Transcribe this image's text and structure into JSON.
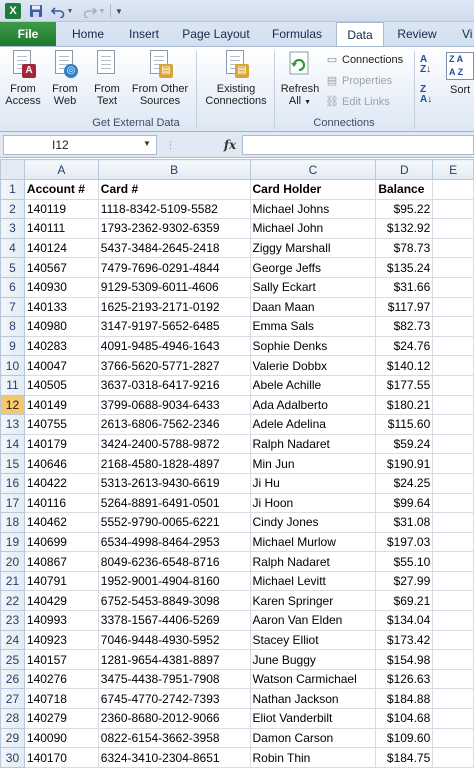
{
  "qat": {
    "logo": "X",
    "icons": [
      "excel-icon",
      "save-icon",
      "undo-icon",
      "redo-icon",
      "customize-icon"
    ]
  },
  "tabs": [
    {
      "id": "file",
      "label": "File"
    },
    {
      "id": "home",
      "label": "Home"
    },
    {
      "id": "insert",
      "label": "Insert"
    },
    {
      "id": "pagelayout",
      "label": "Page Layout"
    },
    {
      "id": "formulas",
      "label": "Formulas"
    },
    {
      "id": "data",
      "label": "Data",
      "active": true
    },
    {
      "id": "review",
      "label": "Review"
    },
    {
      "id": "view",
      "label": "Vi"
    }
  ],
  "ribbon": {
    "get_external": {
      "from_access": "From Access",
      "from_web": "From Web",
      "from_text": "From Text",
      "from_other": "From Other Sources",
      "label": "Get External Data"
    },
    "existing": "Existing Connections",
    "refresh": "Refresh All",
    "connections": {
      "connections": "Connections",
      "properties": "Properties",
      "edit_links": "Edit Links",
      "label": "Connections"
    },
    "sort": "Sort"
  },
  "formula_bar": {
    "name_box": "I12",
    "fx": "fx",
    "value": ""
  },
  "grid": {
    "columns": [
      "A",
      "B",
      "C",
      "D",
      "E"
    ],
    "active_row": 12,
    "header": [
      "Account #",
      "Card #",
      "Card Holder",
      "Balance"
    ],
    "rows": [
      [
        "140119",
        "1118-8342-5109-5582",
        "Michael Johns",
        "$95.22"
      ],
      [
        "140111",
        "1793-2362-9302-6359",
        "Michael John",
        "$132.92"
      ],
      [
        "140124",
        "5437-3484-2645-2418",
        "Ziggy Marshall",
        "$78.73"
      ],
      [
        "140567",
        "7479-7696-0291-4844",
        "George Jeffs",
        "$135.24"
      ],
      [
        "140930",
        "9129-5309-6011-4606",
        "Sally Eckart",
        "$31.66"
      ],
      [
        "140133",
        "1625-2193-2171-0192",
        "Daan Maan",
        "$117.97"
      ],
      [
        "140980",
        "3147-9197-5652-6485",
        "Emma Sals",
        "$82.73"
      ],
      [
        "140283",
        "4091-9485-4946-1643",
        "Sophie Denks",
        "$24.76"
      ],
      [
        "140047",
        "3766-5620-5771-2827",
        "Valerie Dobbx",
        "$140.12"
      ],
      [
        "140505",
        "3637-0318-6417-9216",
        "Abele Achille",
        "$177.55"
      ],
      [
        "140149",
        "3799-0688-9034-6433",
        "Ada Adalberto",
        "$180.21"
      ],
      [
        "140755",
        "2613-6806-7562-2346",
        "Adele Adelina",
        "$115.60"
      ],
      [
        "140179",
        "3424-2400-5788-9872",
        "Ralph Nadaret",
        "$59.24"
      ],
      [
        "140646",
        "2168-4580-1828-4897",
        "Min Jun",
        "$190.91"
      ],
      [
        "140422",
        "5313-2613-9430-6619",
        "Ji Hu",
        "$24.25"
      ],
      [
        "140116",
        "5264-8891-6491-0501",
        "Ji Hoon",
        "$99.64"
      ],
      [
        "140462",
        "5552-9790-0065-6221",
        "Cindy Jones",
        "$31.08"
      ],
      [
        "140699",
        "6534-4998-8464-2953",
        "Michael Murlow",
        "$197.03"
      ],
      [
        "140867",
        "8049-6236-6548-8716",
        "Ralph Nadaret",
        "$55.10"
      ],
      [
        "140791",
        "1952-9001-4904-8160",
        "Michael Levitt",
        "$27.99"
      ],
      [
        "140429",
        "6752-5453-8849-3098",
        "Karen Springer",
        "$69.21"
      ],
      [
        "140993",
        "3378-1567-4406-5269",
        "Aaron Van Elden",
        "$134.04"
      ],
      [
        "140923",
        "7046-9448-4930-5952",
        "Stacey Elliot",
        "$173.42"
      ],
      [
        "140157",
        "1281-9654-4381-8897",
        "June Buggy",
        "$154.98"
      ],
      [
        "140276",
        "3475-4438-7951-7908",
        "Watson Carmichael",
        "$126.63"
      ],
      [
        "140718",
        "6745-4770-2742-7393",
        "Nathan Jackson",
        "$184.88"
      ],
      [
        "140279",
        "2360-8680-2012-9066",
        "Eliot Vanderbilt",
        "$104.68"
      ],
      [
        "140090",
        "0822-6154-3662-3958",
        "Damon Carson",
        "$109.60"
      ],
      [
        "140170",
        "6324-3410-2304-8651",
        "Robin Thin",
        "$184.75"
      ]
    ]
  }
}
